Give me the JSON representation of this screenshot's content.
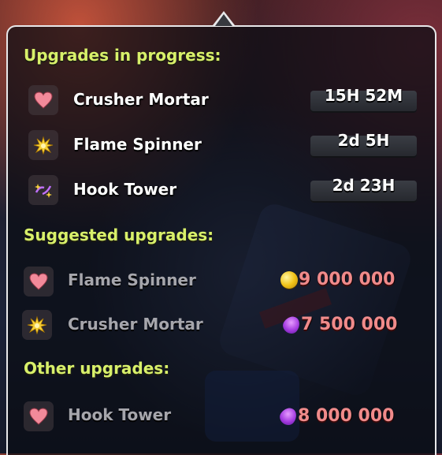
{
  "sections": {
    "in_progress_title": "Upgrades in progress:",
    "suggested_title": "Suggested upgrades:",
    "other_title": "Other upgrades:"
  },
  "in_progress": [
    {
      "name": "Crusher Mortar",
      "time": "15H 52M",
      "icon": "heart-icon"
    },
    {
      "name": "Flame Spinner",
      "time": "2d 5H",
      "icon": "burst-icon"
    },
    {
      "name": "Hook Tower",
      "time": "2d 23H",
      "icon": "sparkle-icon"
    }
  ],
  "suggested": [
    {
      "name": "Flame Spinner",
      "cost": "9 000 000",
      "currency": "gold",
      "icon": "heart-icon"
    },
    {
      "name": "Crusher Mortar",
      "cost": "7 500 000",
      "currency": "elixir",
      "icon": "burst-icon"
    }
  ],
  "other": [
    {
      "name": "Hook Tower",
      "cost": "8 000 000",
      "currency": "elixir",
      "icon": "heart-icon"
    }
  ],
  "colors": {
    "section_title": "#d8f06a",
    "cost_text": "#f08b8b",
    "panel_border": "#e8e8ea"
  }
}
